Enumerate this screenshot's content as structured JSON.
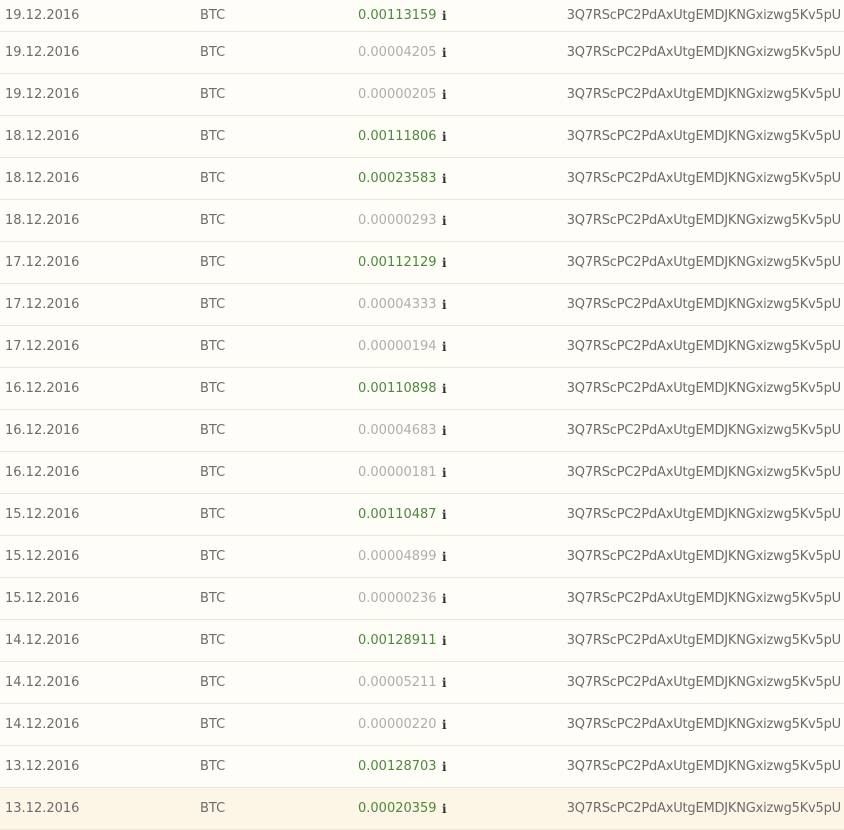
{
  "info_glyph": "i",
  "colors": {
    "amount_green": "#4c8a3a",
    "amount_grey": "#aeaeae",
    "text": "#6c6c6c",
    "row_highlight": "#fdf5e6"
  },
  "rows": [
    {
      "date": "19.12.2016",
      "currency": "BTC",
      "amount": "0.00113159",
      "style": "green",
      "address": "3Q7RScPC2PdAxUtgEMDJKNGxizwg5Kv5pU"
    },
    {
      "date": "19.12.2016",
      "currency": "BTC",
      "amount": "0.00004205",
      "style": "grey",
      "address": "3Q7RScPC2PdAxUtgEMDJKNGxizwg5Kv5pU"
    },
    {
      "date": "19.12.2016",
      "currency": "BTC",
      "amount": "0.00000205",
      "style": "grey",
      "address": "3Q7RScPC2PdAxUtgEMDJKNGxizwg5Kv5pU"
    },
    {
      "date": "18.12.2016",
      "currency": "BTC",
      "amount": "0.00111806",
      "style": "green",
      "address": "3Q7RScPC2PdAxUtgEMDJKNGxizwg5Kv5pU"
    },
    {
      "date": "18.12.2016",
      "currency": "BTC",
      "amount": "0.00023583",
      "style": "green",
      "address": "3Q7RScPC2PdAxUtgEMDJKNGxizwg5Kv5pU"
    },
    {
      "date": "18.12.2016",
      "currency": "BTC",
      "amount": "0.00000293",
      "style": "grey",
      "address": "3Q7RScPC2PdAxUtgEMDJKNGxizwg5Kv5pU"
    },
    {
      "date": "17.12.2016",
      "currency": "BTC",
      "amount": "0.00112129",
      "style": "green",
      "address": "3Q7RScPC2PdAxUtgEMDJKNGxizwg5Kv5pU"
    },
    {
      "date": "17.12.2016",
      "currency": "BTC",
      "amount": "0.00004333",
      "style": "grey",
      "address": "3Q7RScPC2PdAxUtgEMDJKNGxizwg5Kv5pU"
    },
    {
      "date": "17.12.2016",
      "currency": "BTC",
      "amount": "0.00000194",
      "style": "grey",
      "address": "3Q7RScPC2PdAxUtgEMDJKNGxizwg5Kv5pU"
    },
    {
      "date": "16.12.2016",
      "currency": "BTC",
      "amount": "0.00110898",
      "style": "green",
      "address": "3Q7RScPC2PdAxUtgEMDJKNGxizwg5Kv5pU"
    },
    {
      "date": "16.12.2016",
      "currency": "BTC",
      "amount": "0.00004683",
      "style": "grey",
      "address": "3Q7RScPC2PdAxUtgEMDJKNGxizwg5Kv5pU"
    },
    {
      "date": "16.12.2016",
      "currency": "BTC",
      "amount": "0.00000181",
      "style": "grey",
      "address": "3Q7RScPC2PdAxUtgEMDJKNGxizwg5Kv5pU"
    },
    {
      "date": "15.12.2016",
      "currency": "BTC",
      "amount": "0.00110487",
      "style": "green",
      "address": "3Q7RScPC2PdAxUtgEMDJKNGxizwg5Kv5pU"
    },
    {
      "date": "15.12.2016",
      "currency": "BTC",
      "amount": "0.00004899",
      "style": "grey",
      "address": "3Q7RScPC2PdAxUtgEMDJKNGxizwg5Kv5pU"
    },
    {
      "date": "15.12.2016",
      "currency": "BTC",
      "amount": "0.00000236",
      "style": "grey",
      "address": "3Q7RScPC2PdAxUtgEMDJKNGxizwg5Kv5pU"
    },
    {
      "date": "14.12.2016",
      "currency": "BTC",
      "amount": "0.00128911",
      "style": "green",
      "address": "3Q7RScPC2PdAxUtgEMDJKNGxizwg5Kv5pU"
    },
    {
      "date": "14.12.2016",
      "currency": "BTC",
      "amount": "0.00005211",
      "style": "grey",
      "address": "3Q7RScPC2PdAxUtgEMDJKNGxizwg5Kv5pU"
    },
    {
      "date": "14.12.2016",
      "currency": "BTC",
      "amount": "0.00000220",
      "style": "grey",
      "address": "3Q7RScPC2PdAxUtgEMDJKNGxizwg5Kv5pU"
    },
    {
      "date": "13.12.2016",
      "currency": "BTC",
      "amount": "0.00128703",
      "style": "green",
      "address": "3Q7RScPC2PdAxUtgEMDJKNGxizwg5Kv5pU"
    },
    {
      "date": "13.12.2016",
      "currency": "BTC",
      "amount": "0.00020359",
      "style": "green",
      "address": "3Q7RScPC2PdAxUtgEMDJKNGxizwg5Kv5pU",
      "highlighted": true
    }
  ]
}
